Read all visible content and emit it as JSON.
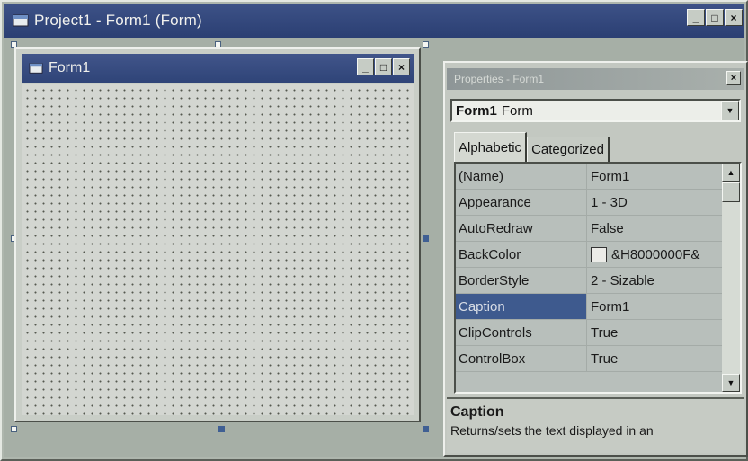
{
  "outer_window": {
    "title": "Project1 - Form1 (Form)",
    "buttons": {
      "minimize": "_",
      "maximize": "□",
      "close": "×"
    }
  },
  "form_window": {
    "title": "Form1",
    "buttons": {
      "minimize": "_",
      "maximize": "□",
      "close": "×"
    }
  },
  "properties_window": {
    "title": "Properties - Form1",
    "close": "×",
    "object_select": {
      "name": "Form1",
      "type": "Form",
      "arrow": "▼"
    },
    "tabs": [
      {
        "label": "Alphabetic",
        "active": true
      },
      {
        "label": "Categorized",
        "active": false
      }
    ],
    "rows": [
      {
        "name": "(Name)",
        "value": "Form1"
      },
      {
        "name": "Appearance",
        "value": "1 - 3D"
      },
      {
        "name": "AutoRedraw",
        "value": "False"
      },
      {
        "name": "BackColor",
        "value": "&H8000000F&",
        "swatch": "#ecece8"
      },
      {
        "name": "BorderStyle",
        "value": "2 - Sizable"
      },
      {
        "name": "Caption",
        "value": "Form1",
        "selected": true
      },
      {
        "name": "ClipControls",
        "value": "True"
      },
      {
        "name": "ControlBox",
        "value": "True"
      }
    ],
    "scroll": {
      "up": "▲",
      "down": "▼"
    },
    "description": {
      "title": "Caption",
      "text": "Returns/sets the text displayed in an"
    }
  },
  "colors": {
    "titlebar_active": "#2f4478",
    "selected_row": "#3e5a8e",
    "background": "#aeb6ad"
  },
  "icons": [
    "form-icon",
    "minimize-icon",
    "maximize-icon",
    "close-icon",
    "dropdown-arrow-icon",
    "scroll-up-icon",
    "scroll-down-icon"
  ]
}
